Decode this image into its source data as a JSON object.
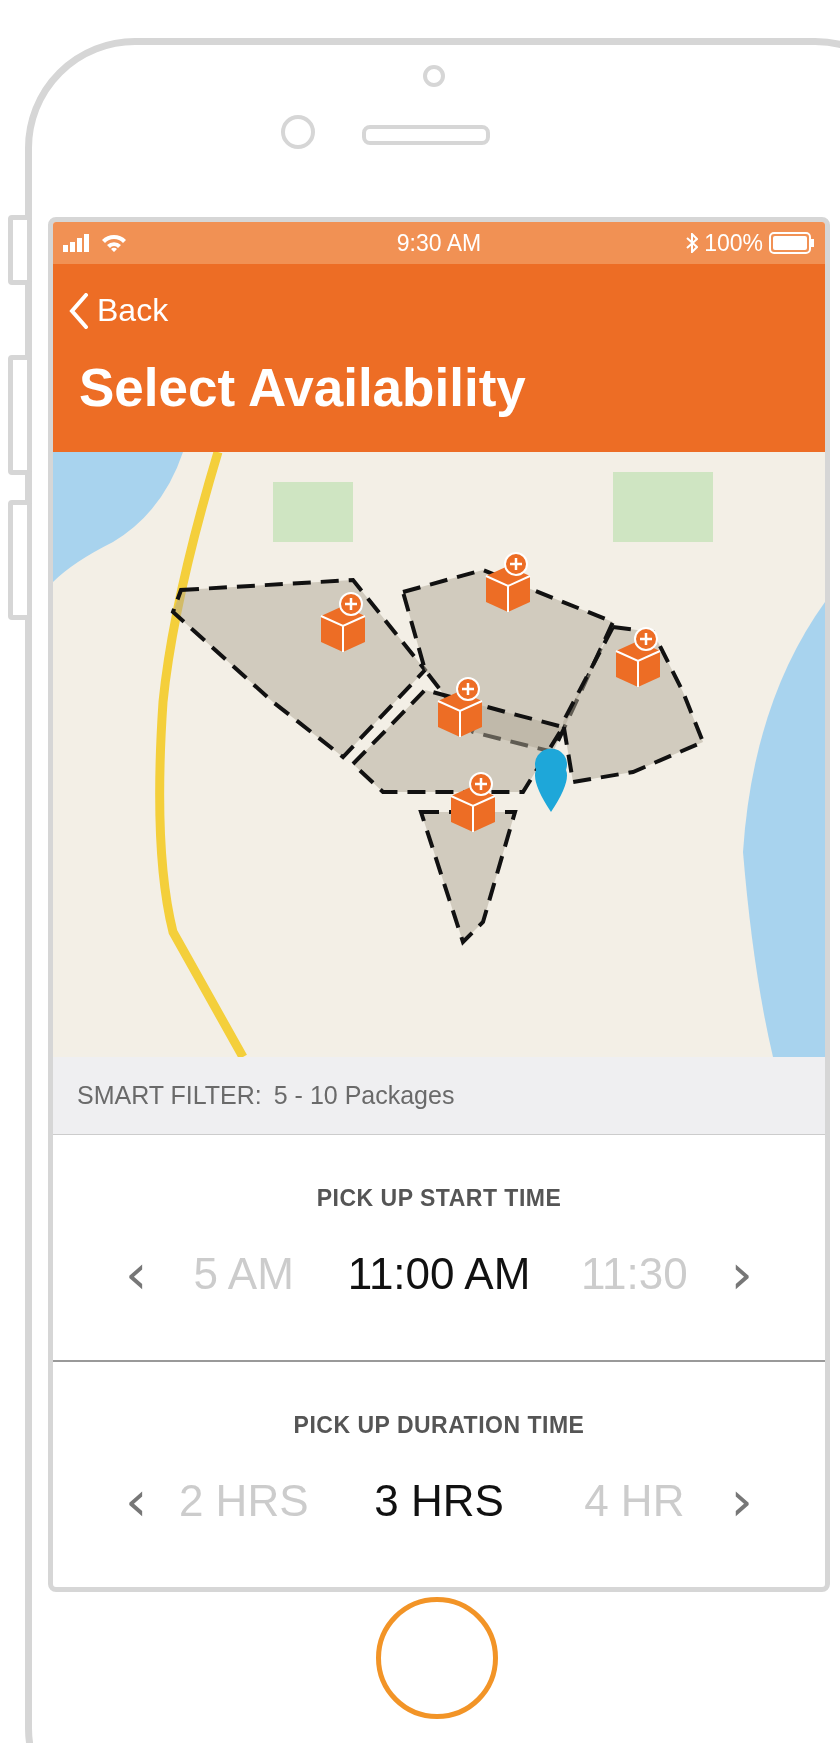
{
  "status_bar": {
    "time": "9:30 AM",
    "battery": "100%"
  },
  "nav": {
    "back": "Back",
    "title": "Select Availability"
  },
  "smart_filter": {
    "label": "SMART FILTER:",
    "value": "5 - 10 Packages"
  },
  "pickers": [
    {
      "label": "PICK UP START TIME",
      "prev": "‹",
      "next": "›",
      "options": [
        {
          "text": "5 AM",
          "selected": false
        },
        {
          "text": "11:00 AM",
          "selected": true
        },
        {
          "text": "11:30",
          "selected": false
        }
      ]
    },
    {
      "label": "PICK UP DURATION TIME",
      "prev": "‹",
      "next": "›",
      "options": [
        {
          "text": "2 HRS",
          "selected": false
        },
        {
          "text": "3 HRS",
          "selected": true
        },
        {
          "text": "4 HR",
          "selected": false
        }
      ]
    }
  ]
}
